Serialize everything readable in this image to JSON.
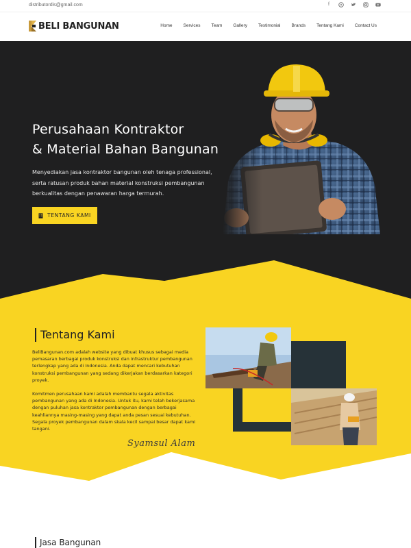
{
  "topbar": {
    "email": "distributordis@gmail.com",
    "socials": [
      "facebook-icon",
      "pinterest-icon",
      "twitter-icon",
      "instagram-icon",
      "youtube-icon"
    ]
  },
  "header": {
    "logo_text": "BELI BANGUNAN",
    "nav": [
      "Home",
      "Services",
      "Team",
      "Gallery",
      "Testimonial",
      "Brands",
      "Tentang Kami",
      "Contact Us"
    ]
  },
  "hero": {
    "title_line1": "Perusahaan Kontraktor",
    "title_line2": "& Material Bahan Bangunan",
    "desc_line1": "Menyediakan jasa kontraktor bangunan oleh tenaga professional,",
    "desc_line2": "serta ratusan produk bahan material konstruksi pembangunan",
    "desc_line3": "berkualitas dengan penawaran harga termurah.",
    "button_label": "TENTANG KAMI"
  },
  "about": {
    "title": "Tentang Kami",
    "paragraph1": "BeliBangunan.com adalah website yang dibuat khusus sebagai media pemasaran berbagai produk konstruksi dan infrastruktur pembangunan terlengkap yang ada di Indonesia. Anda dapat mencari kebutuhan konstruksi pembangunan yang sedang dikerjakan berdasarkan kategori proyek.",
    "paragraph2": "Komitmen perusahaan kami adalah membantu segala aktivitas pembangunan yang ada di Indonesia. Untuk itu, kami telah bekerjasama dengan puluhan jasa kontraktor pembangunan dengan berbagai keahliannya masing-masing yang dapat anda pesan sesuai kebutuhan. Segala proyek pembangunan dalam skala kecil sampai besar dapat kami tangani.",
    "signature": "Syamsul Alam"
  },
  "services": {
    "title": "Jasa Bangunan"
  },
  "colors": {
    "accent": "#f9d422",
    "dark": "#1f1f20"
  }
}
